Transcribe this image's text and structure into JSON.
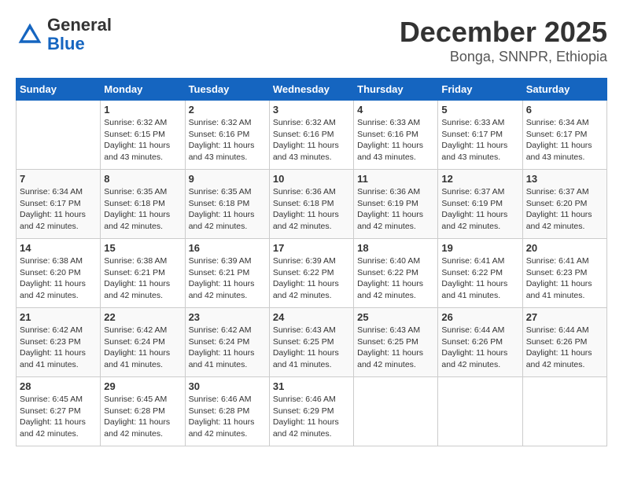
{
  "header": {
    "logo_line1": "General",
    "logo_line2": "Blue",
    "title": "December 2025",
    "location": "Bonga, SNNPR, Ethiopia"
  },
  "weekdays": [
    "Sunday",
    "Monday",
    "Tuesday",
    "Wednesday",
    "Thursday",
    "Friday",
    "Saturday"
  ],
  "weeks": [
    [
      {
        "day": "",
        "detail": ""
      },
      {
        "day": "1",
        "detail": "Sunrise: 6:32 AM\nSunset: 6:15 PM\nDaylight: 11 hours\nand 43 minutes."
      },
      {
        "day": "2",
        "detail": "Sunrise: 6:32 AM\nSunset: 6:16 PM\nDaylight: 11 hours\nand 43 minutes."
      },
      {
        "day": "3",
        "detail": "Sunrise: 6:32 AM\nSunset: 6:16 PM\nDaylight: 11 hours\nand 43 minutes."
      },
      {
        "day": "4",
        "detail": "Sunrise: 6:33 AM\nSunset: 6:16 PM\nDaylight: 11 hours\nand 43 minutes."
      },
      {
        "day": "5",
        "detail": "Sunrise: 6:33 AM\nSunset: 6:17 PM\nDaylight: 11 hours\nand 43 minutes."
      },
      {
        "day": "6",
        "detail": "Sunrise: 6:34 AM\nSunset: 6:17 PM\nDaylight: 11 hours\nand 43 minutes."
      }
    ],
    [
      {
        "day": "7",
        "detail": "Sunrise: 6:34 AM\nSunset: 6:17 PM\nDaylight: 11 hours\nand 42 minutes."
      },
      {
        "day": "8",
        "detail": "Sunrise: 6:35 AM\nSunset: 6:18 PM\nDaylight: 11 hours\nand 42 minutes."
      },
      {
        "day": "9",
        "detail": "Sunrise: 6:35 AM\nSunset: 6:18 PM\nDaylight: 11 hours\nand 42 minutes."
      },
      {
        "day": "10",
        "detail": "Sunrise: 6:36 AM\nSunset: 6:18 PM\nDaylight: 11 hours\nand 42 minutes."
      },
      {
        "day": "11",
        "detail": "Sunrise: 6:36 AM\nSunset: 6:19 PM\nDaylight: 11 hours\nand 42 minutes."
      },
      {
        "day": "12",
        "detail": "Sunrise: 6:37 AM\nSunset: 6:19 PM\nDaylight: 11 hours\nand 42 minutes."
      },
      {
        "day": "13",
        "detail": "Sunrise: 6:37 AM\nSunset: 6:20 PM\nDaylight: 11 hours\nand 42 minutes."
      }
    ],
    [
      {
        "day": "14",
        "detail": "Sunrise: 6:38 AM\nSunset: 6:20 PM\nDaylight: 11 hours\nand 42 minutes."
      },
      {
        "day": "15",
        "detail": "Sunrise: 6:38 AM\nSunset: 6:21 PM\nDaylight: 11 hours\nand 42 minutes."
      },
      {
        "day": "16",
        "detail": "Sunrise: 6:39 AM\nSunset: 6:21 PM\nDaylight: 11 hours\nand 42 minutes."
      },
      {
        "day": "17",
        "detail": "Sunrise: 6:39 AM\nSunset: 6:22 PM\nDaylight: 11 hours\nand 42 minutes."
      },
      {
        "day": "18",
        "detail": "Sunrise: 6:40 AM\nSunset: 6:22 PM\nDaylight: 11 hours\nand 42 minutes."
      },
      {
        "day": "19",
        "detail": "Sunrise: 6:41 AM\nSunset: 6:22 PM\nDaylight: 11 hours\nand 41 minutes."
      },
      {
        "day": "20",
        "detail": "Sunrise: 6:41 AM\nSunset: 6:23 PM\nDaylight: 11 hours\nand 41 minutes."
      }
    ],
    [
      {
        "day": "21",
        "detail": "Sunrise: 6:42 AM\nSunset: 6:23 PM\nDaylight: 11 hours\nand 41 minutes."
      },
      {
        "day": "22",
        "detail": "Sunrise: 6:42 AM\nSunset: 6:24 PM\nDaylight: 11 hours\nand 41 minutes."
      },
      {
        "day": "23",
        "detail": "Sunrise: 6:42 AM\nSunset: 6:24 PM\nDaylight: 11 hours\nand 41 minutes."
      },
      {
        "day": "24",
        "detail": "Sunrise: 6:43 AM\nSunset: 6:25 PM\nDaylight: 11 hours\nand 41 minutes."
      },
      {
        "day": "25",
        "detail": "Sunrise: 6:43 AM\nSunset: 6:25 PM\nDaylight: 11 hours\nand 42 minutes."
      },
      {
        "day": "26",
        "detail": "Sunrise: 6:44 AM\nSunset: 6:26 PM\nDaylight: 11 hours\nand 42 minutes."
      },
      {
        "day": "27",
        "detail": "Sunrise: 6:44 AM\nSunset: 6:26 PM\nDaylight: 11 hours\nand 42 minutes."
      }
    ],
    [
      {
        "day": "28",
        "detail": "Sunrise: 6:45 AM\nSunset: 6:27 PM\nDaylight: 11 hours\nand 42 minutes."
      },
      {
        "day": "29",
        "detail": "Sunrise: 6:45 AM\nSunset: 6:28 PM\nDaylight: 11 hours\nand 42 minutes."
      },
      {
        "day": "30",
        "detail": "Sunrise: 6:46 AM\nSunset: 6:28 PM\nDaylight: 11 hours\nand 42 minutes."
      },
      {
        "day": "31",
        "detail": "Sunrise: 6:46 AM\nSunset: 6:29 PM\nDaylight: 11 hours\nand 42 minutes."
      },
      {
        "day": "",
        "detail": ""
      },
      {
        "day": "",
        "detail": ""
      },
      {
        "day": "",
        "detail": ""
      }
    ]
  ]
}
